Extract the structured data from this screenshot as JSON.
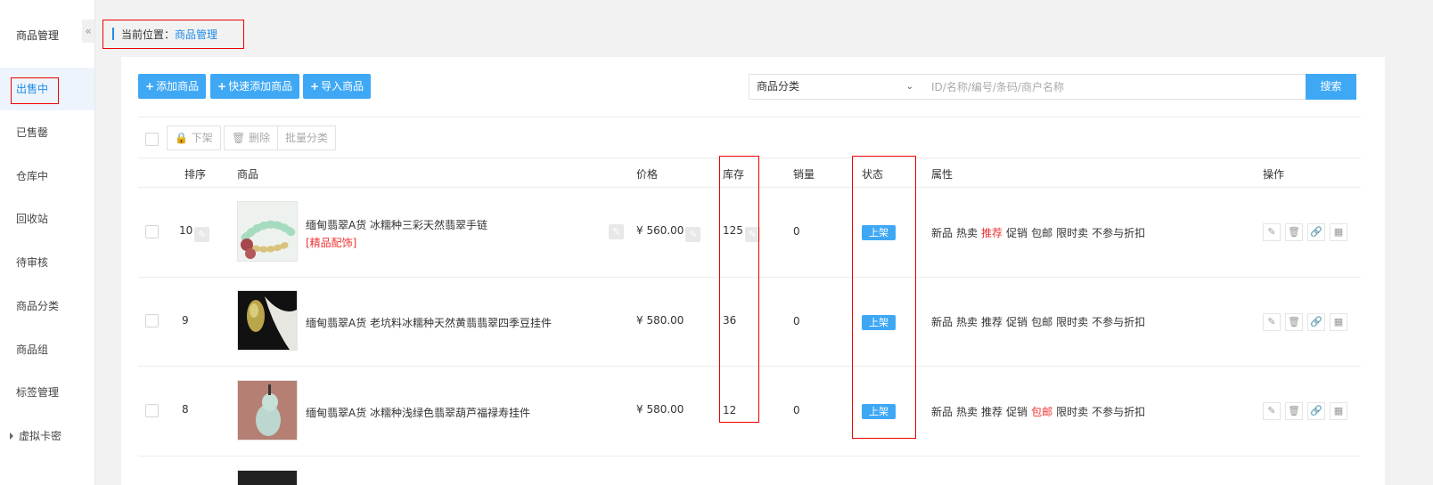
{
  "sidebar": {
    "title": "商品管理",
    "collapse_glyph": "«",
    "items": [
      {
        "label": "出售中"
      },
      {
        "label": "已售罄"
      },
      {
        "label": "仓库中"
      },
      {
        "label": "回收站"
      },
      {
        "label": "待审核"
      },
      {
        "label": "商品分类"
      },
      {
        "label": "商品组"
      },
      {
        "label": "标签管理"
      },
      {
        "label": "虚拟卡密"
      }
    ]
  },
  "breadcrumb": {
    "prefix": "当前位置：",
    "current": "商品管理"
  },
  "toolbar": {
    "add": "添加商品",
    "quick_add": "快速添加商品",
    "import": "导入商品",
    "category_select": "商品分类",
    "search_placeholder": "ID/名称/编号/条码/商户名称",
    "search": "搜索"
  },
  "bulk": {
    "off_shelf": "下架",
    "delete": "删除",
    "batch_category": "批量分类"
  },
  "columns": {
    "sort": "排序",
    "product": "商品",
    "price": "价格",
    "stock": "库存",
    "sales": "销量",
    "status": "状态",
    "attrs": "属性",
    "ops": "操作"
  },
  "rows": [
    {
      "sort": "10",
      "name": "缅甸翡翠A货 冰糯种三彩天然翡翠手链",
      "sub": "[精品配饰]",
      "price": "¥ 560.00",
      "stock": "125",
      "sales": "0",
      "status": "上架",
      "attrs": [
        "新品",
        "热卖",
        "推荐",
        "促销",
        "包邮",
        "限时卖",
        "不参与折扣"
      ],
      "highlight": "推荐"
    },
    {
      "sort": "9",
      "name": "缅甸翡翠A货 老坑料冰糯种天然黄翡翡翠四季豆挂件",
      "sub": "",
      "price": "¥ 580.00",
      "stock": "36",
      "sales": "0",
      "status": "上架",
      "attrs": [
        "新品",
        "热卖",
        "推荐",
        "促销",
        "包邮",
        "限时卖",
        "不参与折扣"
      ],
      "highlight": ""
    },
    {
      "sort": "8",
      "name": "缅甸翡翠A货 冰糯种浅绿色翡翠葫芦福禄寿挂件",
      "sub": "",
      "price": "¥ 580.00",
      "stock": "12",
      "sales": "0",
      "status": "上架",
      "attrs": [
        "新品",
        "热卖",
        "推荐",
        "促销",
        "包邮",
        "限时卖",
        "不参与折扣"
      ],
      "highlight": "包邮"
    }
  ],
  "icons": {
    "edit": "pencil-icon",
    "delete": "trash-icon",
    "link": "link-icon",
    "qrcode": "qrcode-icon"
  }
}
